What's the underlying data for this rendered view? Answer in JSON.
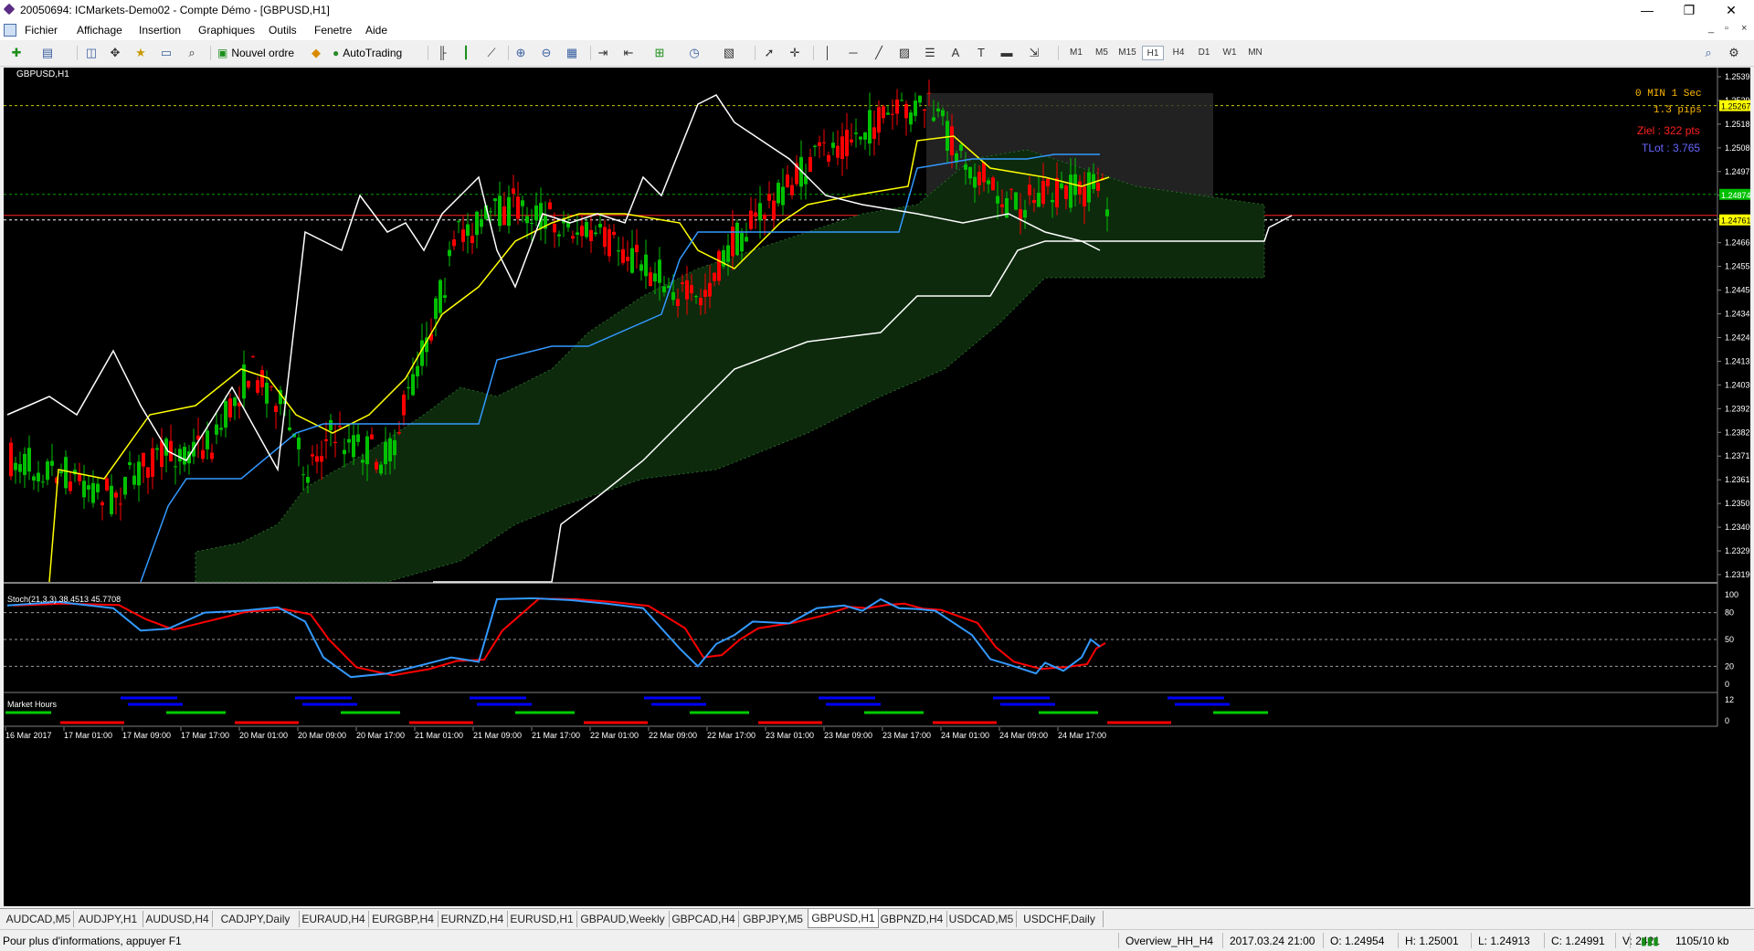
{
  "window": {
    "title": "20050694: ICMarkets-Demo02 - Compte Démo - [GBPUSD,H1]",
    "minimize": "—",
    "maximize": "❐",
    "close": "✕"
  },
  "menu": {
    "items": [
      "Fichier",
      "Affichage",
      "Insertion",
      "Graphiques",
      "Outils",
      "Fenetre",
      "Aide"
    ],
    "mdi_min": "_",
    "mdi_restore": "▫",
    "mdi_close": "×"
  },
  "toolbar": {
    "new_order_label": "Nouvel ordre",
    "autotrading_label": "AutoTrading",
    "timeframes": [
      "M1",
      "M5",
      "M15",
      "H1",
      "H4",
      "D1",
      "W1",
      "MN"
    ],
    "active_timeframe": "H1"
  },
  "chart": {
    "symbol_label": "GBPUSD,H1",
    "info": {
      "timer": "0 MIN 1 Sec",
      "pips": "1.3 pips",
      "ziel": "Ziel : 322 pts",
      "tlot": "TLot : 3.765"
    },
    "price_axis": [
      "1.25395",
      "1.25290",
      "1.25185",
      "1.25080",
      "1.24975",
      "1.24870",
      "1.24765",
      "1.24660",
      "1.24555",
      "1.24450",
      "1.24345",
      "1.24240",
      "1.24135",
      "1.24030",
      "1.23925",
      "1.23820",
      "1.23715",
      "1.23610",
      "1.23505",
      "1.23400",
      "1.23295",
      "1.23190"
    ],
    "price_tags": {
      "ask": "1.25267",
      "bid": "1.24874",
      "line": "1.24761"
    },
    "colors": {
      "background": "#000000",
      "bull_candle": "#00c000",
      "bear_candle": "#ff0000",
      "tenkan": "#ffff00",
      "kijun": "#3399ff",
      "chikou": "#ffffff",
      "stoch_main": "#3399ff",
      "stoch_signal": "#ff0000",
      "session_blue": "#0000ff",
      "session_green": "#00cc00",
      "session_red": "#ff0000"
    }
  },
  "stochastic": {
    "label": "Stoch(21,3,3) 38.4513 45.7708",
    "levels": [
      "100",
      "80",
      "50",
      "20",
      "0"
    ]
  },
  "market_hours": {
    "label": "Market Hours",
    "levels": [
      "12",
      "0"
    ]
  },
  "time_axis": [
    "16 Mar 2017",
    "17 Mar 01:00",
    "17 Mar 09:00",
    "17 Mar 17:00",
    "20 Mar 01:00",
    "20 Mar 09:00",
    "20 Mar 17:00",
    "21 Mar 01:00",
    "21 Mar 09:00",
    "21 Mar 17:00",
    "22 Mar 01:00",
    "22 Mar 09:00",
    "22 Mar 17:00",
    "23 Mar 01:00",
    "23 Mar 09:00",
    "23 Mar 17:00",
    "24 Mar 01:00",
    "24 Mar 09:00",
    "24 Mar 17:00"
  ],
  "tabs": [
    "AUDCAD,M5",
    "AUDJPY,H1",
    "AUDUSD,H4",
    "CADJPY,Daily",
    "EURAUD,H4",
    "EURGBP,H4",
    "EURNZD,H4",
    "EURUSD,H1",
    "GBPAUD,Weekly",
    "GBPCAD,H4",
    "GBPJPY,M5",
    "GBPUSD,H1",
    "GBPNZD,H4",
    "USDCAD,M5",
    "USDCHF,Daily"
  ],
  "active_tab": "GBPUSD,H1",
  "status": {
    "help": "Pour plus d'informations, appuyer F1",
    "profile": "Overview_HH_H4",
    "datetime": "2017.03.24 21:00",
    "open": "O: 1.24954",
    "high": "H: 1.25001",
    "low": "L: 1.24913",
    "close": "C: 1.24991",
    "volume": "V: 2421",
    "traffic": "1105/10 kb"
  }
}
